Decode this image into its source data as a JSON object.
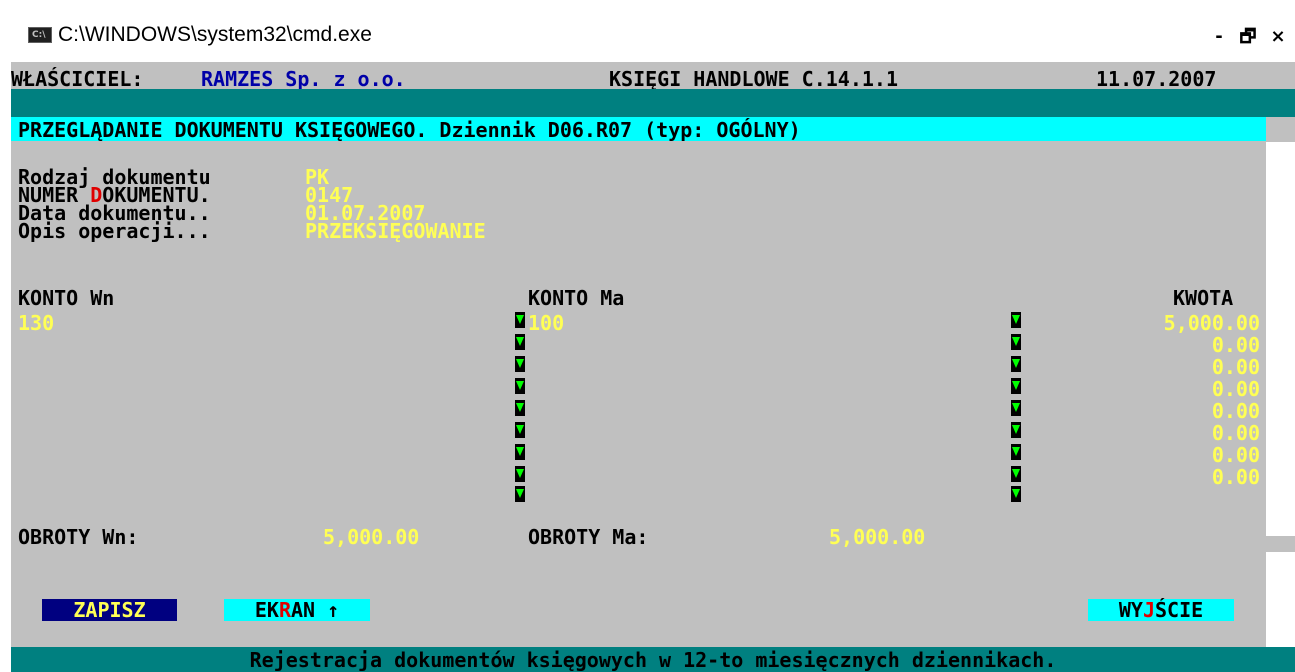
{
  "window": {
    "title": "C:\\WINDOWS\\system32\\cmd.exe",
    "icon_text": "C:\\",
    "controls": {
      "minimize": "-",
      "maximize": "Θ",
      "close": "×"
    }
  },
  "header": {
    "owner_label": "WŁAŚCICIEL:",
    "owner_name": "RAMZES Sp. z o.o.",
    "program": "KSIĘGI HANDLOWE C.14.1.1",
    "date": "11.07.2007"
  },
  "section_title": "PRZEGLĄDANIE DOKUMENTU KSIĘGOWEGO. Dziennik D06.R07 (typ: OGÓLNY)",
  "doc": {
    "type_label": "Rodzaj dokumentu",
    "type_value": "PK",
    "number_label_pre": "NUMER ",
    "number_label_hot": "D",
    "number_label_post": "OKUMENTU.",
    "number_value": "0147",
    "date_label": "Data dokumentu..",
    "date_value": "01.07.2007",
    "desc_label": "Opis operacji...",
    "desc_value": "PRZEKSIĘGOWANIE"
  },
  "table": {
    "col_wn": "KONTO Wn",
    "col_ma": "KONTO Ma",
    "col_amount": "KWOTA",
    "rows": [
      {
        "wn": "130",
        "ma": "100",
        "amount": "5,000.00"
      },
      {
        "wn": "",
        "ma": "",
        "amount": "0.00"
      },
      {
        "wn": "",
        "ma": "",
        "amount": "0.00"
      },
      {
        "wn": "",
        "ma": "",
        "amount": "0.00"
      },
      {
        "wn": "",
        "ma": "",
        "amount": "0.00"
      },
      {
        "wn": "",
        "ma": "",
        "amount": "0.00"
      },
      {
        "wn": "",
        "ma": "",
        "amount": "0.00"
      },
      {
        "wn": "",
        "ma": "",
        "amount": "0.00"
      }
    ]
  },
  "totals": {
    "wn_label": "OBROTY Wn:",
    "wn_value": "5,000.00",
    "ma_label": "OBROTY Ma:",
    "ma_value": "5,000.00"
  },
  "buttons": {
    "save": "ZAPISZ",
    "screen_pre": "EK",
    "screen_hot": "R",
    "screen_post": "AN ↑",
    "exit_pre": "WY",
    "exit_hot": "J",
    "exit_post": "ŚCIE"
  },
  "status": "Rejestracja dokumentów księgowych w 12-to miesięcznych dziennikach.",
  "colors": {
    "console_bg": "#c0c0c0",
    "value_text": "#ffff55",
    "bar_teal": "#008080",
    "bar_cyan": "#00ffff",
    "hotkey": "#e00000",
    "save_button_bg": "#000080",
    "arrow": "#00ff00"
  }
}
